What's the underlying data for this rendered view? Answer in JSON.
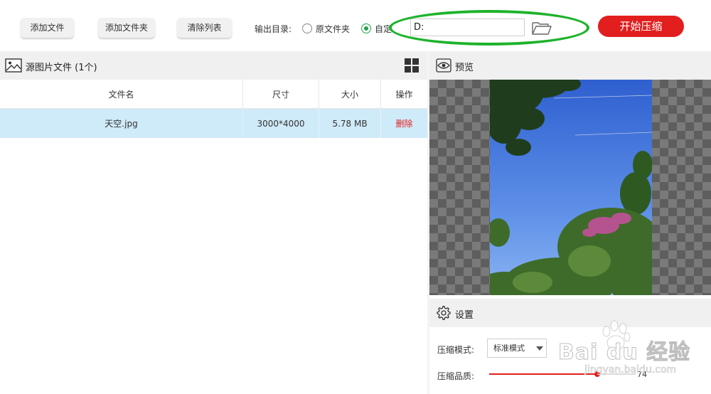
{
  "toolbar": {
    "add_file": "添加文件",
    "add_folder": "添加文件夹",
    "clear_list": "清除列表",
    "output_label": "输出目录:",
    "radio_original": "原文件夹",
    "radio_custom": "自定",
    "path_value": "D:",
    "start": "开始压缩",
    "selected_output": "自定"
  },
  "source": {
    "title": "源图片文件 (1个)",
    "columns": [
      "文件名",
      "尺寸",
      "大小",
      "操作"
    ],
    "rows": [
      {
        "name": "天空.jpg",
        "size": "3000*4000",
        "filesize": "5.78 MB",
        "action": "删除"
      }
    ]
  },
  "preview": {
    "title": "预览"
  },
  "settings": {
    "title": "设置",
    "mode_label": "压缩模式:",
    "mode_value": "标准模式",
    "quality_label": "压缩品质:",
    "quality_value": "74",
    "quality_fraction": 0.74
  },
  "watermark": {
    "text": "Bai du 经验",
    "sub": "jingyan.baidu.com"
  },
  "colors": {
    "accent_red": "#e21e1e",
    "highlight_green": "#1db32b",
    "row_selected": "#cfeaf8"
  },
  "icons": [
    "image-icon",
    "grid-view-icon",
    "eye-icon",
    "gear-icon",
    "folder-open-icon",
    "chevron-down-icon"
  ]
}
